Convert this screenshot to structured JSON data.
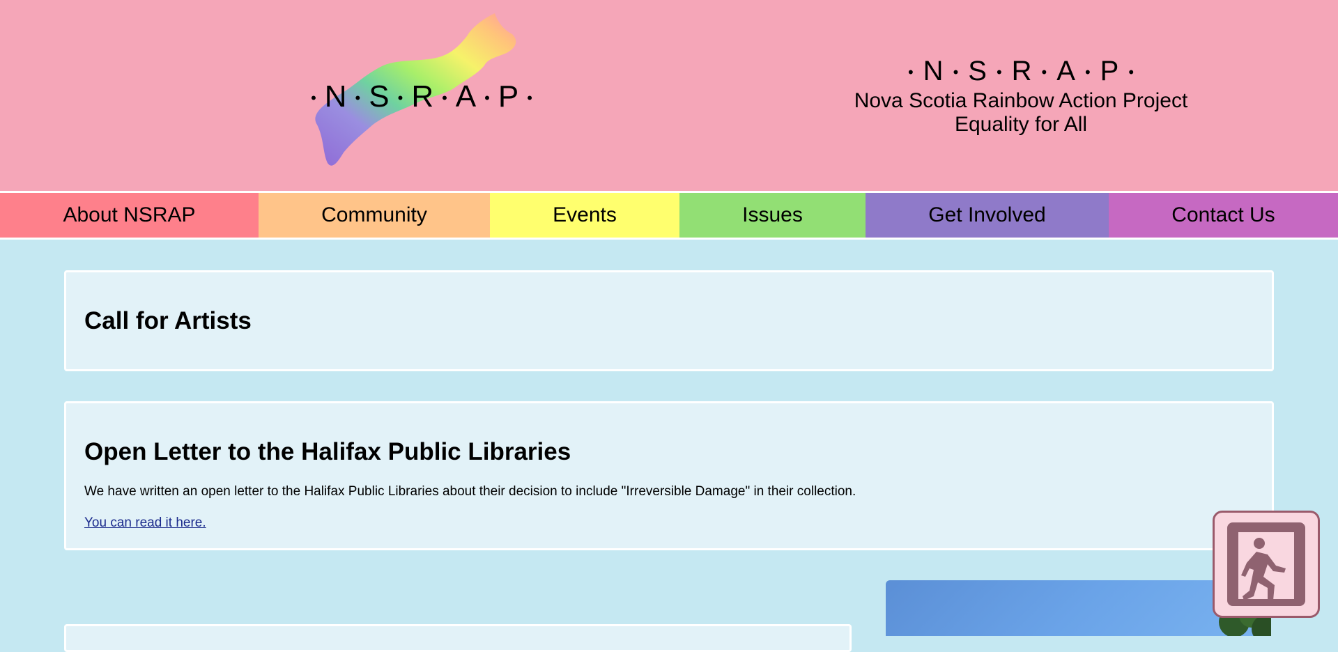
{
  "logo": {
    "letters": [
      "N",
      "S",
      "R",
      "A",
      "P"
    ],
    "separator": "•"
  },
  "tagline": {
    "acronym_letters": [
      "N",
      "S",
      "R",
      "A",
      "P"
    ],
    "separator": "•",
    "name": "Nova Scotia Rainbow Action Project",
    "slogan": "Equality for All"
  },
  "nav": {
    "items": [
      {
        "label": "About NSRAP",
        "color": "#fe808b"
      },
      {
        "label": "Community",
        "color": "#ffc489"
      },
      {
        "label": "Events",
        "color": "#ffff6e"
      },
      {
        "label": "Issues",
        "color": "#92df74"
      },
      {
        "label": "Get Involved",
        "color": "#8f7ac9"
      },
      {
        "label": "Contact Us",
        "color": "#c669c2"
      }
    ]
  },
  "posts": [
    {
      "title": "Call for Artists"
    },
    {
      "title": "Open Letter to the Halifax Public Libraries",
      "body": "We have written an open letter to the Halifax Public Libraries about their decision to include \"Irreversible Damage\" in their collection.",
      "link": "You can read it here."
    }
  ],
  "exit_button": {
    "icon": "exit-icon"
  },
  "colors": {
    "header_bg": "#f5a6b8",
    "page_bg": "#c5e8f2",
    "card_bg": "#e2f2f8",
    "link": "#1a2a8c"
  }
}
